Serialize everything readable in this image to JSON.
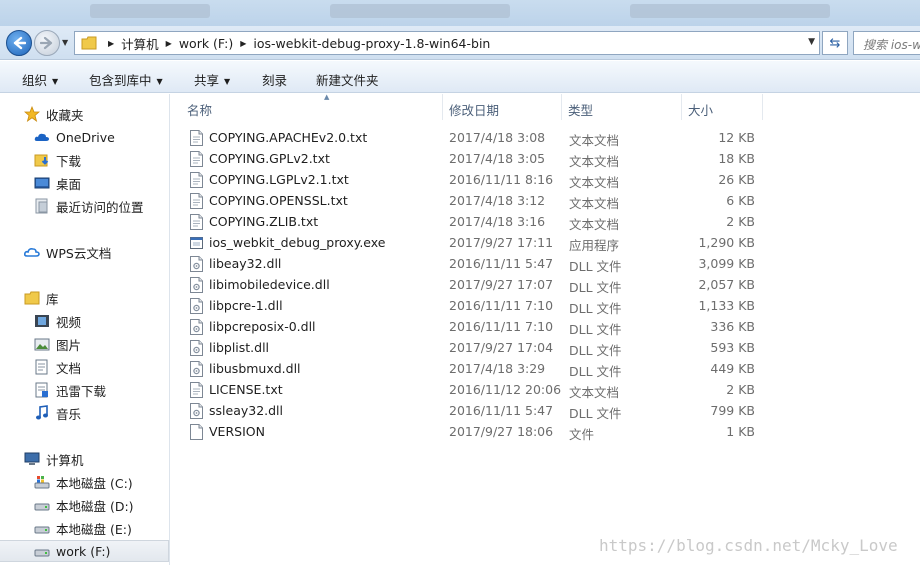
{
  "address": {
    "crumbs": [
      "计算机",
      "work (F:)",
      "ios-webkit-debug-proxy-1.8-win64-bin"
    ],
    "search_placeholder": "搜索 ios-w"
  },
  "toolbar": {
    "organize": "组织",
    "include_in_library": "包含到库中",
    "share": "共享",
    "burn": "刻录",
    "new_folder": "新建文件夹"
  },
  "sidebar": {
    "favorites": "收藏夹",
    "onedrive": "OneDrive",
    "downloads": "下载",
    "desktop": "桌面",
    "recent": "最近访问的位置",
    "wps": "WPS云文档",
    "libraries": "库",
    "videos": "视频",
    "pictures": "图片",
    "documents": "文档",
    "thunder": "迅雷下载",
    "music": "音乐",
    "computer": "计算机",
    "drive_c": "本地磁盘 (C:)",
    "drive_d": "本地磁盘 (D:)",
    "drive_e": "本地磁盘 (E:)",
    "drive_f": "work (F:)"
  },
  "columns": {
    "name": "名称",
    "modified": "修改日期",
    "type": "类型",
    "size": "大小"
  },
  "files": [
    {
      "name": "COPYING.APACHEv2.0.txt",
      "date": "2017/4/18 3:08",
      "type": "文本文档",
      "size": "12 KB",
      "icon": "text-file-icon"
    },
    {
      "name": "COPYING.GPLv2.txt",
      "date": "2017/4/18 3:05",
      "type": "文本文档",
      "size": "18 KB",
      "icon": "text-file-icon"
    },
    {
      "name": "COPYING.LGPLv2.1.txt",
      "date": "2016/11/11 8:16",
      "type": "文本文档",
      "size": "26 KB",
      "icon": "text-file-icon"
    },
    {
      "name": "COPYING.OPENSSL.txt",
      "date": "2017/4/18 3:12",
      "type": "文本文档",
      "size": "6 KB",
      "icon": "text-file-icon"
    },
    {
      "name": "COPYING.ZLIB.txt",
      "date": "2017/4/18 3:16",
      "type": "文本文档",
      "size": "2 KB",
      "icon": "text-file-icon"
    },
    {
      "name": "ios_webkit_debug_proxy.exe",
      "date": "2017/9/27 17:11",
      "type": "应用程序",
      "size": "1,290 KB",
      "icon": "exe-file-icon"
    },
    {
      "name": "libeay32.dll",
      "date": "2016/11/11 5:47",
      "type": "DLL 文件",
      "size": "3,099 KB",
      "icon": "dll-file-icon"
    },
    {
      "name": "libimobiledevice.dll",
      "date": "2017/9/27 17:07",
      "type": "DLL 文件",
      "size": "2,057 KB",
      "icon": "dll-file-icon"
    },
    {
      "name": "libpcre-1.dll",
      "date": "2016/11/11 7:10",
      "type": "DLL 文件",
      "size": "1,133 KB",
      "icon": "dll-file-icon"
    },
    {
      "name": "libpcreposix-0.dll",
      "date": "2016/11/11 7:10",
      "type": "DLL 文件",
      "size": "336 KB",
      "icon": "dll-file-icon"
    },
    {
      "name": "libplist.dll",
      "date": "2017/9/27 17:04",
      "type": "DLL 文件",
      "size": "593 KB",
      "icon": "dll-file-icon"
    },
    {
      "name": "libusbmuxd.dll",
      "date": "2017/4/18 3:29",
      "type": "DLL 文件",
      "size": "449 KB",
      "icon": "dll-file-icon"
    },
    {
      "name": "LICENSE.txt",
      "date": "2016/11/12 20:06",
      "type": "文本文档",
      "size": "2 KB",
      "icon": "text-file-icon"
    },
    {
      "name": "ssleay32.dll",
      "date": "2016/11/11 5:47",
      "type": "DLL 文件",
      "size": "799 KB",
      "icon": "dll-file-icon"
    },
    {
      "name": "VERSION",
      "date": "2017/9/27 18:06",
      "type": "文件",
      "size": "1 KB",
      "icon": "blank-file-icon"
    }
  ],
  "watermark": "https://blog.csdn.net/Mcky_Love"
}
